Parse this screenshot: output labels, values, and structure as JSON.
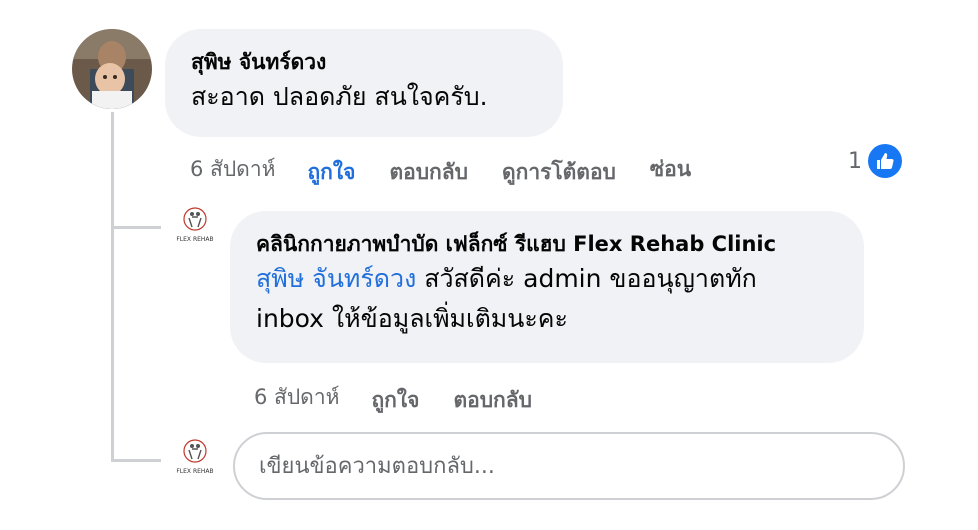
{
  "comment": {
    "author": "สุพิษ จันทร์ดวง",
    "text": "สะอาด ปลอดภัย  สนใจครับ.",
    "time": "6 สัปดาห์",
    "like_label": "ถูกใจ",
    "reply_label": "ตอบกลับ",
    "view_replies_label": "ดูการโต้ตอบ",
    "hide_label": "ซ่อน",
    "reaction_count": "1"
  },
  "reply": {
    "author": "คลินิกกายภาพบำบัด เฟล็กซ์ รีแฮบ Flex Rehab Clinic",
    "mention": "สุพิษ จันทร์ดวง",
    "text_line1": " สวัสดีค่ะ admin ขออนุญาตทัก",
    "text_line2": "inbox ให้ข้อมูลเพิ่มเติมนะคะ",
    "time": "6 สัปดาห์",
    "like_label": "ถูกใจ",
    "reply_label": "ตอบกลับ"
  },
  "composer": {
    "placeholder": "เขียนข้อความตอบกลับ..."
  },
  "clinic_logo": {
    "text": "FLEX REHAB"
  },
  "colors": {
    "accent": "#216fdb",
    "bubble": "#f0f2f5",
    "meta": "#65676b",
    "like_badge": "#1877f2"
  }
}
